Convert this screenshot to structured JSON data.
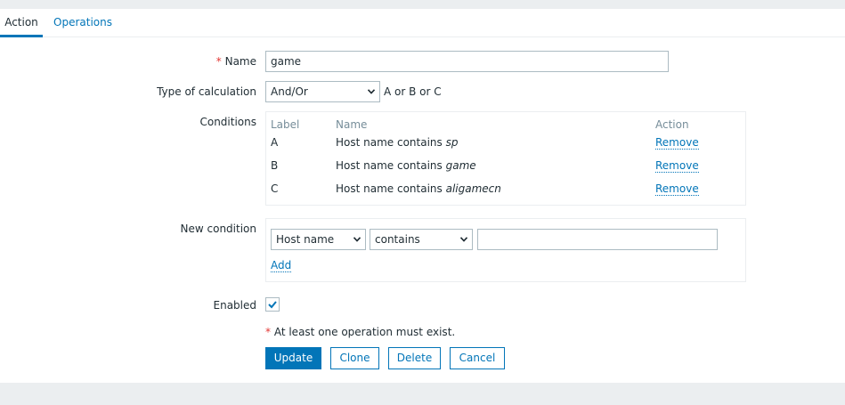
{
  "tabs": [
    {
      "label": "Action",
      "active": true
    },
    {
      "label": "Operations",
      "active": false
    }
  ],
  "form": {
    "name_label": "Name",
    "required_mark": "*",
    "name_value": "game",
    "calc_label": "Type of calculation",
    "calc_value": "And/Or",
    "calc_formula": "A or B or C",
    "conditions_label": "Conditions",
    "conditions_headers": {
      "label": "Label",
      "name": "Name",
      "action": "Action"
    },
    "conditions": [
      {
        "label": "A",
        "text": "Host name contains",
        "value": "sp",
        "action": "Remove"
      },
      {
        "label": "B",
        "text": "Host name contains",
        "value": "game",
        "action": "Remove"
      },
      {
        "label": "C",
        "text": "Host name contains",
        "value": "aligamecn",
        "action": "Remove"
      }
    ],
    "new_condition_label": "New condition",
    "new_condition_type": "Host name",
    "new_condition_operator": "contains",
    "new_condition_value": "",
    "add_label": "Add",
    "enabled_label": "Enabled",
    "enabled": true,
    "warning": "At least one operation must exist."
  },
  "buttons": {
    "update": "Update",
    "clone": "Clone",
    "delete": "Delete",
    "cancel": "Cancel"
  },
  "colors": {
    "accent": "#0275b8",
    "required": "#e33734",
    "background": "#ebeef0"
  }
}
